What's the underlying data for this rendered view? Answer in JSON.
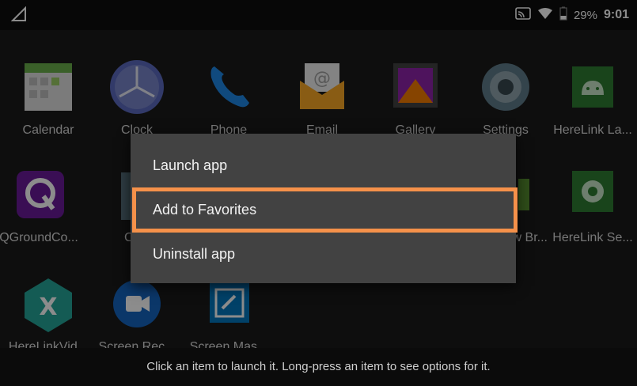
{
  "status": {
    "battery": "29%",
    "time": "9:01"
  },
  "apps": [
    {
      "label": "Calendar",
      "icon": "calendar-icon"
    },
    {
      "label": "Clock",
      "icon": "clock-icon"
    },
    {
      "label": "Phone",
      "icon": "phone-icon"
    },
    {
      "label": "Email",
      "icon": "email-icon"
    },
    {
      "label": "Gallery",
      "icon": "gallery-icon"
    },
    {
      "label": "Settings",
      "icon": "settings-icon"
    },
    {
      "label": "HereLink La...",
      "icon": "android-icon"
    },
    {
      "label": "QGroundCo...",
      "icon": "qgroundcontrol-icon"
    },
    {
      "label": "Calc",
      "icon": "calculator-icon"
    },
    {
      "label": "w Br...",
      "icon": "browser-icon"
    },
    {
      "label": "HereLink Se...",
      "icon": "herelink-settings-icon"
    },
    {
      "label": "HereLinkVid...",
      "icon": "herelink-video-icon"
    },
    {
      "label": "Screen Rec...",
      "icon": "screen-recorder-icon"
    },
    {
      "label": "Screen Mas...",
      "icon": "screen-master-icon"
    }
  ],
  "menu": {
    "items": [
      "Launch app",
      "Add to Favorites",
      "Uninstall app"
    ],
    "highlighted_item": "Add to Favorites",
    "highlight_color": "#f5914a"
  },
  "hint": "Click an item to launch it. Long-press an item to see options for it."
}
